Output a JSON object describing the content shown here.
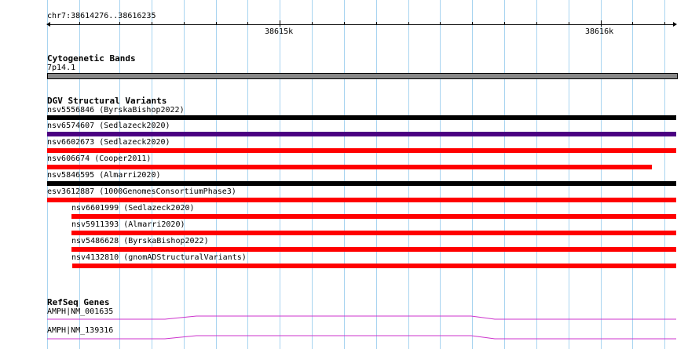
{
  "ruler": {
    "location": "chr7:38614276..38616235",
    "tick_major_1": "38615k",
    "tick_major_2": "38616k"
  },
  "cytoband_track": {
    "title": "Cytogenetic Bands",
    "band_label": "7p14.1",
    "band_color": "#888888"
  },
  "dgv_track": {
    "title": "DGV Structural Variants",
    "features": [
      {
        "label": "nsv5556846 (ByrskaBishop2022)",
        "color": "#000000"
      },
      {
        "label": "nsv6574607 (Sedlazeck2020)",
        "color": "#4b0082"
      },
      {
        "label": "nsv6602673 (Sedlazeck2020)",
        "color": "#ff0000"
      },
      {
        "label": "nsv606674 (Cooper2011)",
        "color": "#ff0000"
      },
      {
        "label": "nsv5846595 (Almarri2020)",
        "color": "#000000"
      },
      {
        "label": "esv3612887 (1000GenomesConsortiumPhase3)",
        "color": "#ff0000"
      },
      {
        "label": "nsv6601999 (Sedlazeck2020)",
        "color": "#ff0000"
      },
      {
        "label": "nsv5911393 (Almarri2020)",
        "color": "#ff0000"
      },
      {
        "label": "nsv5486628 (ByrskaBishop2022)",
        "color": "#ff0000"
      },
      {
        "label": "nsv4132810 (gnomADStructuralVariants)",
        "color": "#ff0000"
      }
    ]
  },
  "refseq_track": {
    "title": "RefSeq Genes",
    "genes": [
      {
        "label": "AMPH|NM_001635",
        "color": "#cc33cc"
      },
      {
        "label": "AMPH|NM_139316",
        "color": "#cc33cc"
      }
    ]
  }
}
